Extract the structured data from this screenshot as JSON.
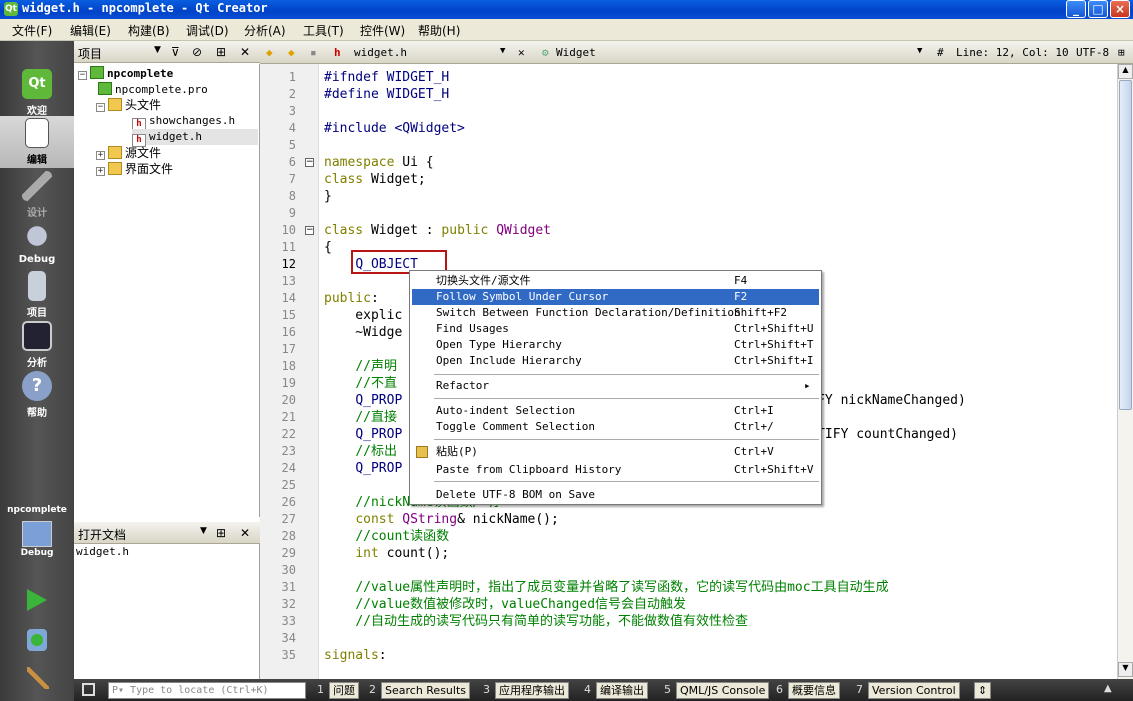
{
  "window": {
    "title": "widget.h - npcomplete - Qt Creator",
    "app_icon": "qt-icon"
  },
  "menubar": [
    "文件(F)",
    "编辑(E)",
    "构建(B)",
    "调试(D)",
    "分析(A)",
    "工具(T)",
    "控件(W)",
    "帮助(H)"
  ],
  "modes": [
    {
      "label": "欢迎",
      "icon": "qt-logo-icon"
    },
    {
      "label": "编辑",
      "icon": "edit-document-icon",
      "selected": true
    },
    {
      "label": "设计",
      "icon": "design-pencil-icon"
    },
    {
      "label": "Debug",
      "icon": "debug-bug-icon"
    },
    {
      "label": "项目",
      "icon": "project-icon"
    },
    {
      "label": "分析",
      "icon": "analyze-monitor-icon"
    },
    {
      "label": "帮助",
      "icon": "help-question-icon"
    }
  ],
  "target": {
    "project": "npcomplete",
    "config": "Debug"
  },
  "project_panel": {
    "title": "项目",
    "tree": [
      {
        "label": "npcomplete",
        "depth": 0,
        "icon": "project-folder-icon",
        "expanded": true
      },
      {
        "label": "npcomplete.pro",
        "depth": 1,
        "icon": "pro-file-icon"
      },
      {
        "label": "头文件",
        "depth": 1,
        "icon": "folder-icon",
        "expanded": true
      },
      {
        "label": "showchanges.h",
        "depth": 2,
        "icon": "header-file-icon"
      },
      {
        "label": "widget.h",
        "depth": 2,
        "icon": "header-file-icon",
        "selected": true
      },
      {
        "label": "源文件",
        "depth": 1,
        "icon": "folder-icon",
        "expanded": false
      },
      {
        "label": "界面文件",
        "depth": 1,
        "icon": "folder-icon",
        "expanded": false
      }
    ]
  },
  "open_docs_panel": {
    "title": "打开文档",
    "items": [
      "widget.h"
    ]
  },
  "editor_toolbar": {
    "file": "widget.h",
    "symbol": "Widget",
    "hash": "#",
    "position": "Line: 12, Col: 10",
    "encoding": "UTF-8"
  },
  "code_lines": [
    {
      "n": "1",
      "text": "#ifndef WIDGET_H"
    },
    {
      "n": "2",
      "text": "#define WIDGET_H"
    },
    {
      "n": "3",
      "text": ""
    },
    {
      "n": "4",
      "text": "#include <QWidget>"
    },
    {
      "n": "5",
      "text": ""
    },
    {
      "n": "6",
      "text": "namespace Ui {",
      "fold": true
    },
    {
      "n": "7",
      "text": "class Widget;"
    },
    {
      "n": "8",
      "text": "}"
    },
    {
      "n": "9",
      "text": ""
    },
    {
      "n": "10",
      "text": "class Widget : public QWidget",
      "fold": true
    },
    {
      "n": "11",
      "text": "{"
    },
    {
      "n": "12",
      "text": "    Q_OBJECT",
      "current": true
    },
    {
      "n": "13",
      "text": ""
    },
    {
      "n": "14",
      "text": "public:"
    },
    {
      "n": "15",
      "text": "    explic"
    },
    {
      "n": "16",
      "text": "    ~Widge"
    },
    {
      "n": "17",
      "text": ""
    },
    {
      "n": "18",
      "text": "    //声明"
    },
    {
      "n": "19",
      "text": "    //不直"
    },
    {
      "n": "20",
      "text": "    Q_PROP                                        NickName NOTIFY nickNameChanged)"
    },
    {
      "n": "21",
      "text": "    //直接"
    },
    {
      "n": "22",
      "text": "    Q_PROP                                        E setCount NOTIFY countChanged)"
    },
    {
      "n": "23",
      "text": "    //标出"
    },
    {
      "n": "24",
      "text": "    Q_PROP                                        Changed)"
    },
    {
      "n": "25",
      "text": ""
    },
    {
      "n": "26",
      "text": "    //nickName读函数声明"
    },
    {
      "n": "27",
      "text": "    const QString& nickName();"
    },
    {
      "n": "28",
      "text": "    //count读函数"
    },
    {
      "n": "29",
      "text": "    int count();"
    },
    {
      "n": "30",
      "text": ""
    },
    {
      "n": "31",
      "text": "    //value属性声明时，指出了成员变量并省略了读写函数，它的读写代码由moc工具自动生成"
    },
    {
      "n": "32",
      "text": "    //value数值被修改时，valueChanged信号会自动触发"
    },
    {
      "n": "33",
      "text": "    //自动生成的读写代码只有简单的读写功能，不能做数值有效性检查"
    },
    {
      "n": "34",
      "text": ""
    },
    {
      "n": "35",
      "text": "signals:"
    }
  ],
  "context_menu": [
    {
      "label": "切换头文件/源文件",
      "shortcut": "F4"
    },
    {
      "label": "Follow Symbol Under Cursor",
      "shortcut": "F2",
      "highlighted": true
    },
    {
      "label": "Switch Between Function Declaration/Definition",
      "shortcut": "Shift+F2"
    },
    {
      "label": "Find Usages",
      "shortcut": "Ctrl+Shift+U"
    },
    {
      "label": "Open Type Hierarchy",
      "shortcut": "Ctrl+Shift+T"
    },
    {
      "label": "Open Include Hierarchy",
      "shortcut": "Ctrl+Shift+I"
    },
    {
      "separator": true
    },
    {
      "label": "Refactor",
      "shortcut": "▸"
    },
    {
      "separator": true
    },
    {
      "label": "Auto-indent Selection",
      "shortcut": "Ctrl+I"
    },
    {
      "label": "Toggle Comment Selection",
      "shortcut": "Ctrl+/"
    },
    {
      "separator": true
    },
    {
      "label": "粘贴(P)",
      "shortcut": "Ctrl+V",
      "icon": "paste-icon"
    },
    {
      "label": "Paste from Clipboard History",
      "shortcut": "Ctrl+Shift+V"
    },
    {
      "separator": true
    },
    {
      "label": "Delete UTF-8 BOM on Save",
      "shortcut": ""
    }
  ],
  "statusbar": {
    "locate_placeholder": "P▾ Type to locate (Ctrl+K)",
    "panes": [
      {
        "n": "1",
        "label": "问题"
      },
      {
        "n": "2",
        "label": "Search Results"
      },
      {
        "n": "3",
        "label": "应用程序输出"
      },
      {
        "n": "4",
        "label": "编译输出"
      },
      {
        "n": "5",
        "label": "QML/JS Console"
      },
      {
        "n": "6",
        "label": "概要信息"
      },
      {
        "n": "7",
        "label": "Version Control"
      }
    ]
  },
  "colors": {
    "accent": "#316ac5",
    "highlight_box": "#b81414",
    "keyword": "#808000",
    "comment": "#008000",
    "type": "#800080"
  }
}
